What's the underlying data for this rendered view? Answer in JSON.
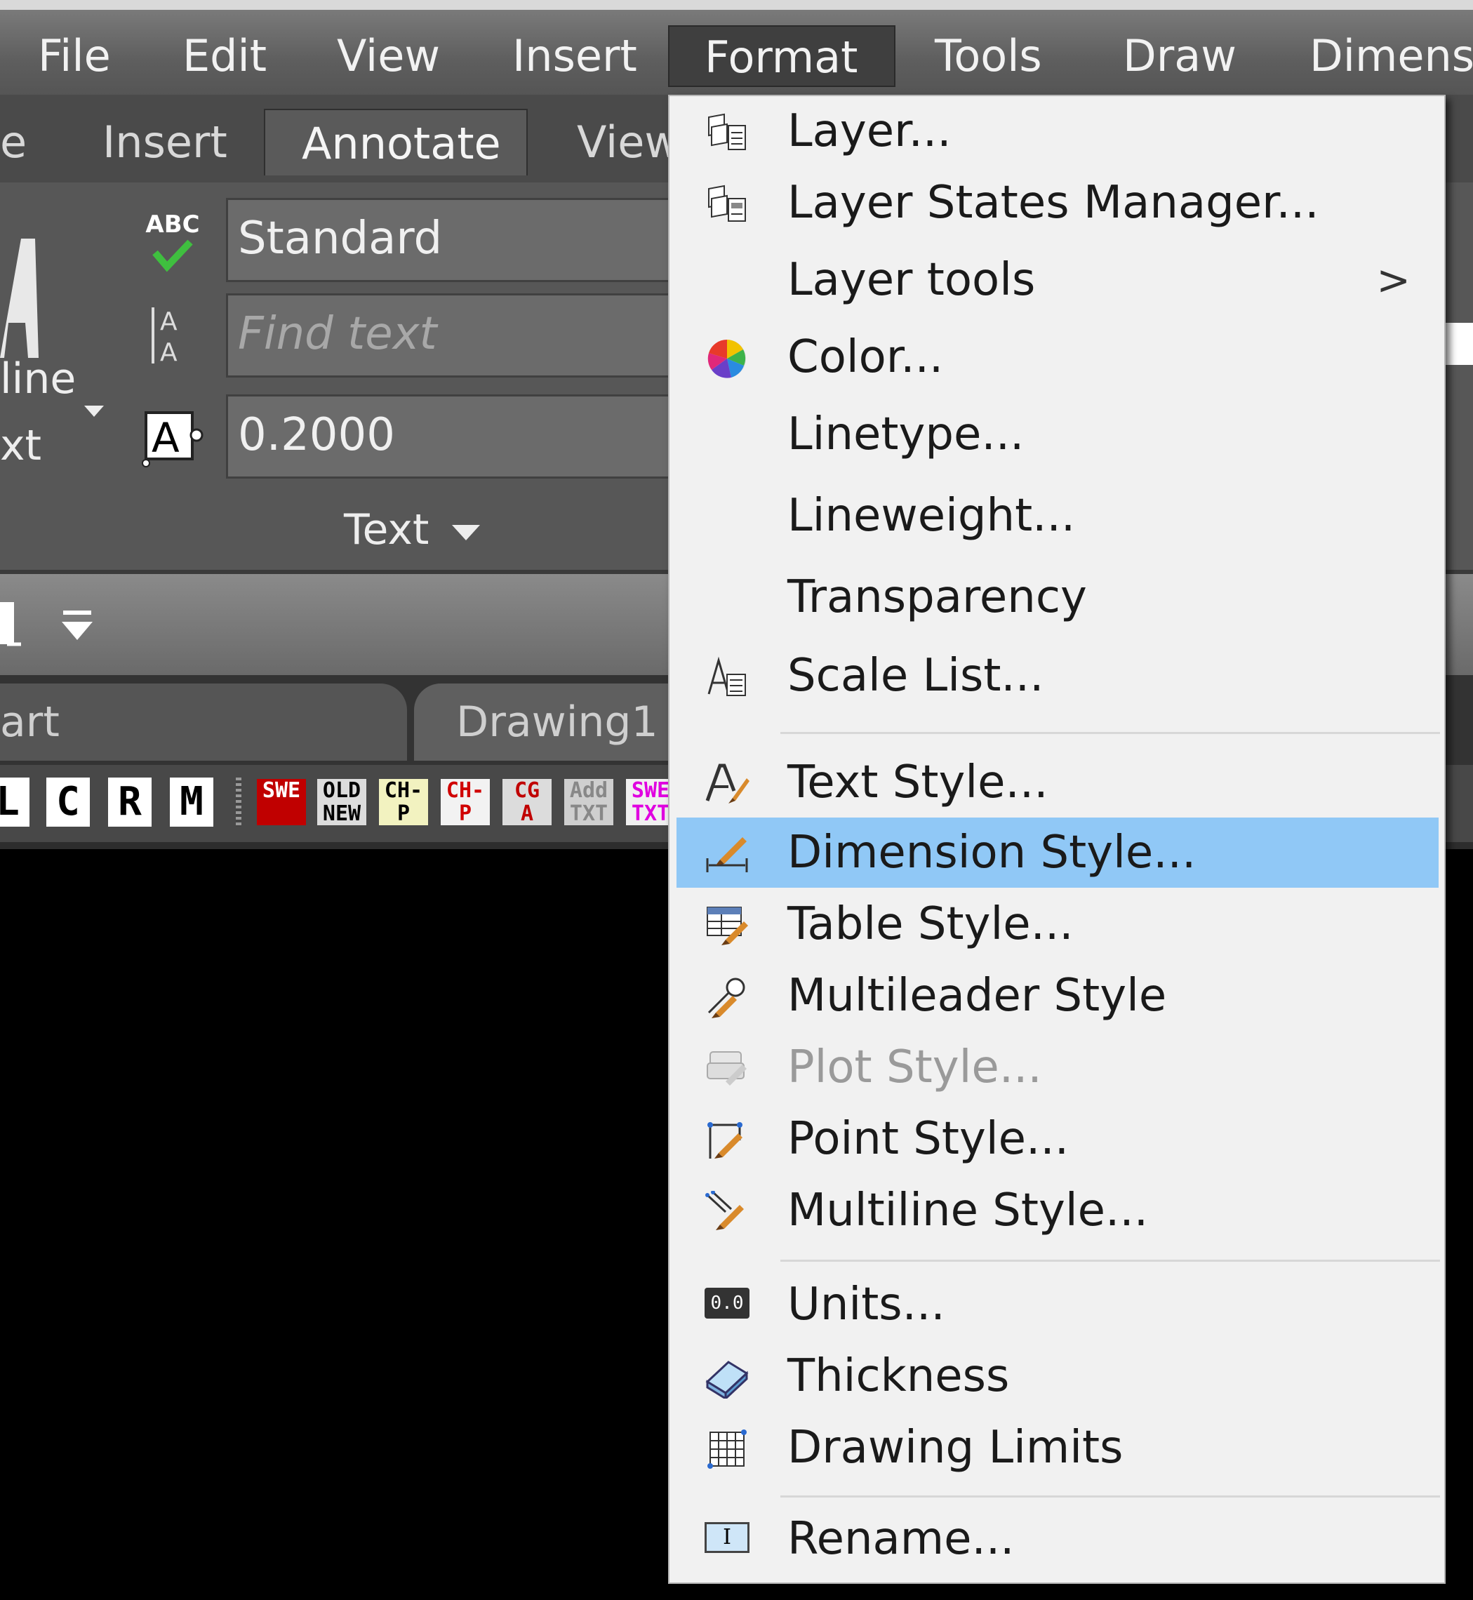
{
  "menubar": {
    "items": [
      "File",
      "Edit",
      "View",
      "Insert",
      "Format",
      "Tools",
      "Draw",
      "Dimensi"
    ]
  },
  "ribbon": {
    "tabs": [
      "e",
      "Insert",
      "Annotate",
      "View"
    ],
    "text_style": "Standard",
    "find_placeholder": "Find text",
    "text_height": "0.2000",
    "panel_title": "Text",
    "left_label_1": "line",
    "left_label_2": "xt",
    "spell_icon_text": "ABC"
  },
  "file_tabs": [
    "art",
    "Drawing1"
  ],
  "letter_buttons": [
    "L",
    "C",
    "R",
    "M"
  ],
  "toolbar_icons": [
    {
      "text": "SWE",
      "color": "#ffffff",
      "bg": "#c00000"
    },
    {
      "text": "OLD NEW",
      "color": "#000000",
      "bg": "#dcdcdc"
    },
    {
      "text": "CH-P",
      "color": "#000000",
      "bg": "#f2f2c0"
    },
    {
      "text": "CH-P",
      "color": "#d00000",
      "bg": "#f2f2f2"
    },
    {
      "text": "CG A",
      "color": "#c00000",
      "bg": "#dcdcdc"
    },
    {
      "text": "Add TXT",
      "color": "#888888",
      "bg": "#cfcfcf"
    },
    {
      "text": "SWE TXT",
      "color": "#e000e0",
      "bg": "#f0f0f0"
    }
  ],
  "dropdown": {
    "items": [
      {
        "label": "Layer...",
        "icon": "layer-icon"
      },
      {
        "label": "Layer States Manager...",
        "icon": "layer-states-icon"
      },
      {
        "label": "Layer tools",
        "icon": "",
        "submenu": ">"
      },
      {
        "label": "Color...",
        "icon": "color-wheel-icon"
      },
      {
        "label": "Linetype...",
        "icon": ""
      },
      {
        "label": "Lineweight...",
        "icon": ""
      },
      {
        "label": "Transparency",
        "icon": ""
      },
      {
        "label": "Scale List...",
        "icon": "scale-list-icon"
      },
      {
        "label": "Text Style...",
        "icon": "text-style-icon"
      },
      {
        "label": "Dimension Style...",
        "icon": "dimension-style-icon"
      },
      {
        "label": "Table Style...",
        "icon": "table-style-icon"
      },
      {
        "label": "Multileader Style",
        "icon": "multileader-style-icon"
      },
      {
        "label": "Plot Style...",
        "icon": "plot-style-icon"
      },
      {
        "label": "Point Style...",
        "icon": "point-style-icon"
      },
      {
        "label": "Multiline Style...",
        "icon": "multiline-style-icon"
      },
      {
        "label": "Units...",
        "icon": "units-icon",
        "icon_text": "0.0"
      },
      {
        "label": "Thickness",
        "icon": "thickness-icon"
      },
      {
        "label": "Drawing Limits",
        "icon": "drawing-limits-icon"
      },
      {
        "label": "Rename...",
        "icon": "rename-icon",
        "icon_text": "I"
      }
    ]
  },
  "colors": {
    "highlight": "#90c8f6",
    "menu_bg": "#f1f1f1",
    "disabled_text": "#9a9a9a"
  }
}
